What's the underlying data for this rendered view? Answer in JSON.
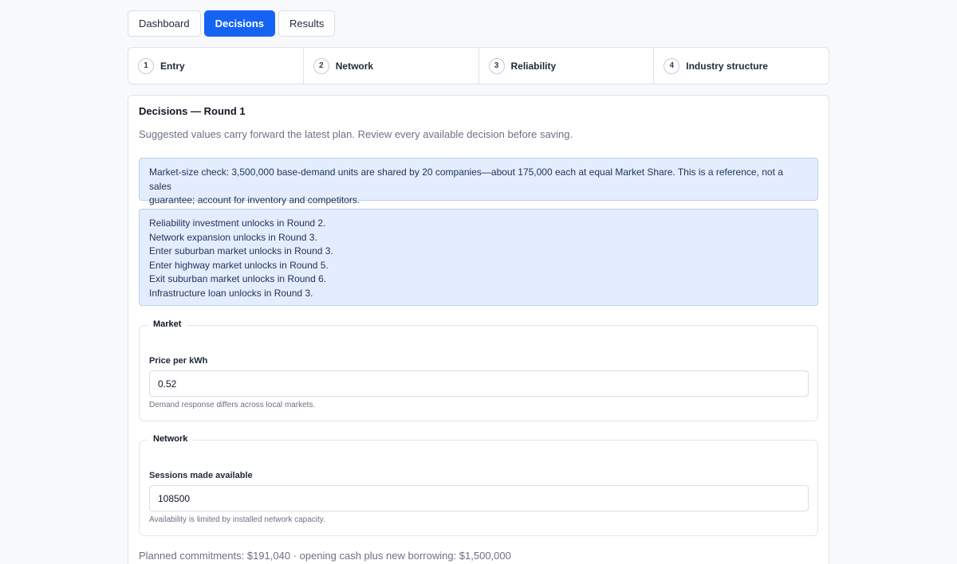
{
  "tabs": [
    {
      "label": "Dashboard",
      "active": false
    },
    {
      "label": "Decisions",
      "active": true
    },
    {
      "label": "Results",
      "active": false
    }
  ],
  "steps": [
    {
      "number": "1",
      "label": "Entry"
    },
    {
      "number": "2",
      "label": "Network"
    },
    {
      "number": "3",
      "label": "Reliability"
    },
    {
      "number": "4",
      "label": "Industry structure"
    }
  ],
  "card": {
    "title": "Decisions — Round 1",
    "subtitle": "Suggested values carry forward the latest plan. Review every available decision before saving."
  },
  "market_check": {
    "line1": "Market-size check: 3,500,000 base-demand units are shared by 20 companies—about 175,000 each at equal Market Share. This is a reference, not a sales",
    "line2": "guarantee; account for inventory and competitors."
  },
  "unlocks": [
    "Reliability investment unlocks in Round 2.",
    "Network expansion unlocks in Round 3.",
    "Enter suburban market unlocks in Round 3.",
    "Enter highway market unlocks in Round 5.",
    "Exit suburban market unlocks in Round 6.",
    "Infrastructure loan unlocks in Round 3."
  ],
  "market": {
    "legend": "Market",
    "label": "Price per kWh",
    "value": "0.52",
    "help": "Demand response differs across local markets."
  },
  "network": {
    "legend": "Network",
    "label": "Sessions made available",
    "value": "108500",
    "help": "Availability is limited by installed network capacity."
  },
  "summary": "Planned commitments: $191,040 · opening cash plus new borrowing: $1,500,000",
  "colors": {
    "accent": "#1463f3",
    "info_bg": "#e4edfd",
    "info_border": "#bcd0f1"
  }
}
